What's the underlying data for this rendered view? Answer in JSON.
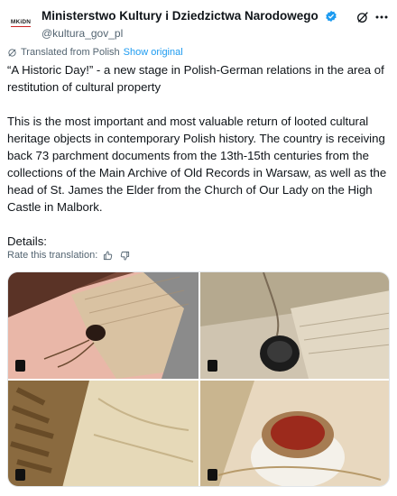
{
  "account": {
    "avatar_text": "MKiDN",
    "display_name": "Ministerstwo Kultury i Dziedzictwa Narodowego",
    "handle": "@kultura_gov_pl"
  },
  "translation": {
    "note": "Translated from Polish",
    "show_original": "Show original",
    "rate_label": "Rate this translation:"
  },
  "tweet": {
    "paragraphs": [
      "“A Historic Day!” - a new stage in Polish-German relations in the area of restitution of cultural property",
      "This is the most important and most valuable return of looted cultural heritage objects in contemporary Polish history. The country is receiving back 73 parchment documents from the 13th-15th centuries from the collections of the Main Archive of Old Records in Warsaw, as well as the head of St. James the Elder from the Church of Our Lady on the High Castle in Malbork.",
      "Details:"
    ]
  },
  "colors": {
    "text": "#0f1419",
    "secondary": "#536471",
    "link": "#1d9bf0",
    "verified": "#1d9bf0"
  },
  "icons": [
    "verified-badge-icon",
    "grok-icon",
    "more-icon",
    "translate-icon",
    "thumbs-up-icon",
    "thumbs-down-icon",
    "gif-badge-icon"
  ]
}
